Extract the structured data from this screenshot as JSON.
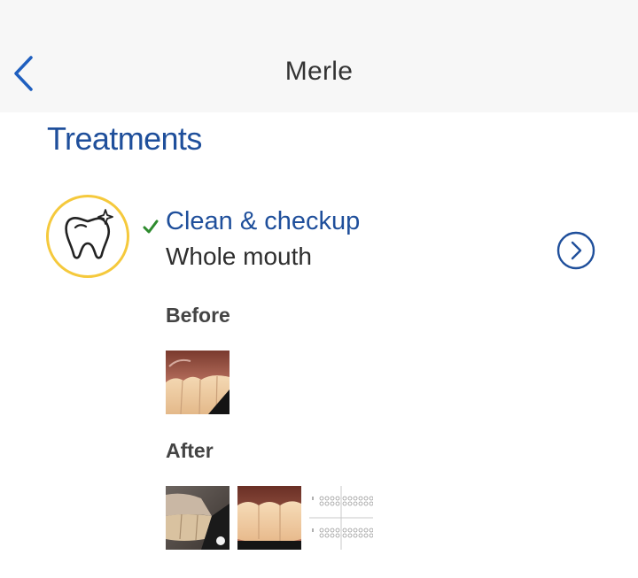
{
  "nav": {
    "title": "Merle",
    "back_icon": "chevron-left-icon"
  },
  "section": {
    "title": "Treatments"
  },
  "treatment": {
    "name": "Clean & checkup",
    "area": "Whole mouth",
    "status": "completed",
    "icon": "tooth-sparkle-icon",
    "badge_color": "#f5c93c",
    "accent_color": "#1f4f9b",
    "check_color": "#2e8b2e"
  },
  "photos": {
    "before_label": "Before",
    "after_label": "After",
    "before": [
      {
        "kind": "teeth-photo"
      }
    ],
    "after": [
      {
        "kind": "teeth-photo"
      },
      {
        "kind": "teeth-photo"
      },
      {
        "kind": "chart-document"
      }
    ]
  }
}
